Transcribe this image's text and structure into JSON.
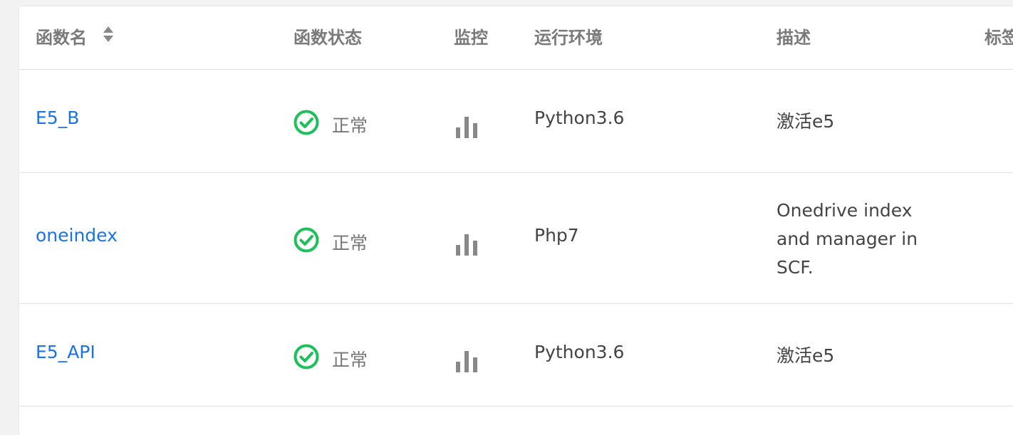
{
  "table": {
    "headers": {
      "name": "函数名",
      "status": "函数状态",
      "monitor": "监控",
      "runtime": "运行环境",
      "description": "描述",
      "tags": "标签"
    },
    "rows": [
      {
        "name": "E5_B",
        "status": "正常",
        "runtime": "Python3.6",
        "description": "激活e5"
      },
      {
        "name": "oneindex",
        "status": "正常",
        "runtime": "Php7",
        "description": "Onedrive index and manager in SCF."
      },
      {
        "name": "E5_API",
        "status": "正常",
        "runtime": "Python3.6",
        "description": "激活e5"
      }
    ]
  },
  "colors": {
    "link": "#1a73e8",
    "status_ok": "#1cc15c",
    "icon_gray": "#888888"
  },
  "icons": {
    "sort": "sort-icon",
    "status": "check-circle-icon",
    "monitor": "bar-chart-icon"
  }
}
